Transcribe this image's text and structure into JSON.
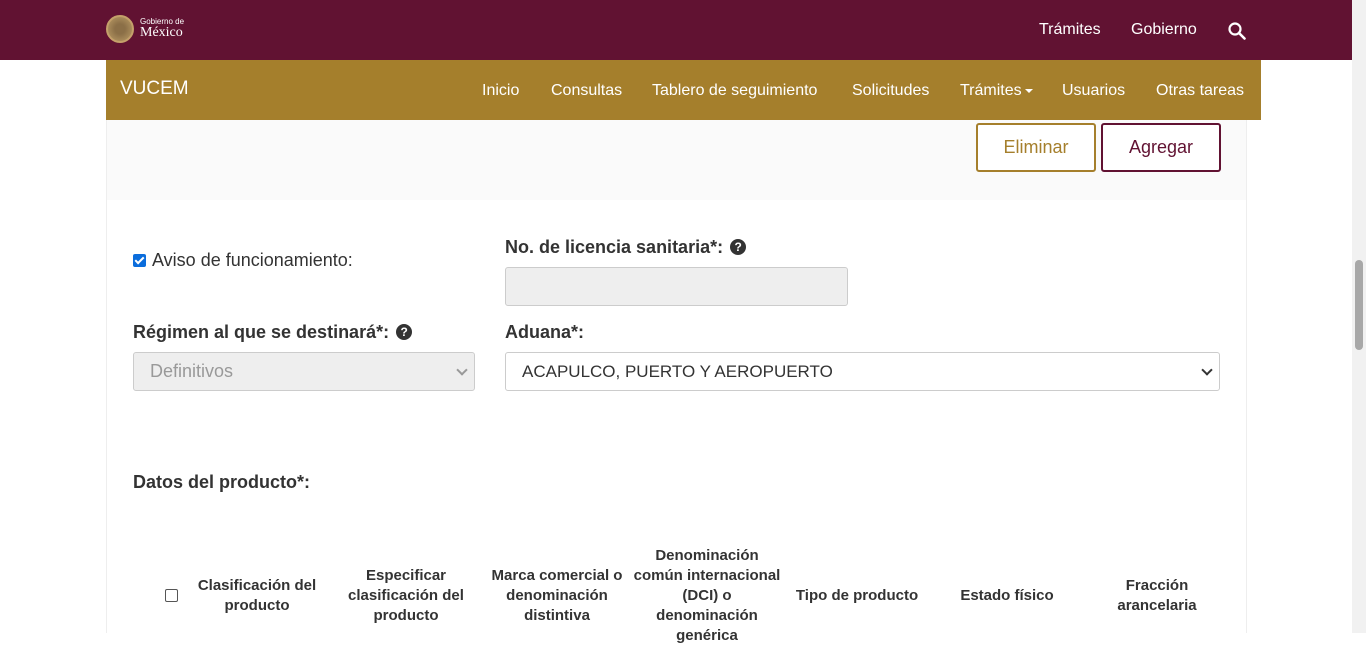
{
  "gov_header": {
    "logo_small": "Gobierno de",
    "logo_big": "México",
    "nav": [
      "Trámites",
      "Gobierno"
    ]
  },
  "vucem_nav": {
    "brand": "VUCEM",
    "items": [
      "Inicio",
      "Consultas",
      "Tablero de seguimiento",
      "Solicitudes",
      "Trámites",
      "Usuarios",
      "Otras tareas"
    ]
  },
  "actions": {
    "delete_label": "Eliminar",
    "add_label": "Agregar"
  },
  "form": {
    "aviso_label": "Aviso de funcionamiento:",
    "aviso_checked": true,
    "licencia_label": "No. de licencia sanitaria*:",
    "licencia_value": "",
    "regimen_label": "Régimen al que se destinará*:",
    "regimen_value": "Definitivos",
    "aduana_label": "Aduana*:",
    "aduana_value": "ACAPULCO, PUERTO Y AEROPUERTO"
  },
  "product_section": {
    "title": "Datos del producto*:",
    "columns": [
      "Clasificación del producto",
      "Especificar clasificación del producto",
      "Marca comercial o denominación distintiva",
      "Denominación común internacional (DCI) o denominación genérica",
      "Tipo de producto",
      "Estado físico",
      "Fracción arancelaria"
    ]
  },
  "colors": {
    "gov_bar": "#611232",
    "vucem_bar": "#a57f2c",
    "checkbox": "#0b6ddc"
  }
}
